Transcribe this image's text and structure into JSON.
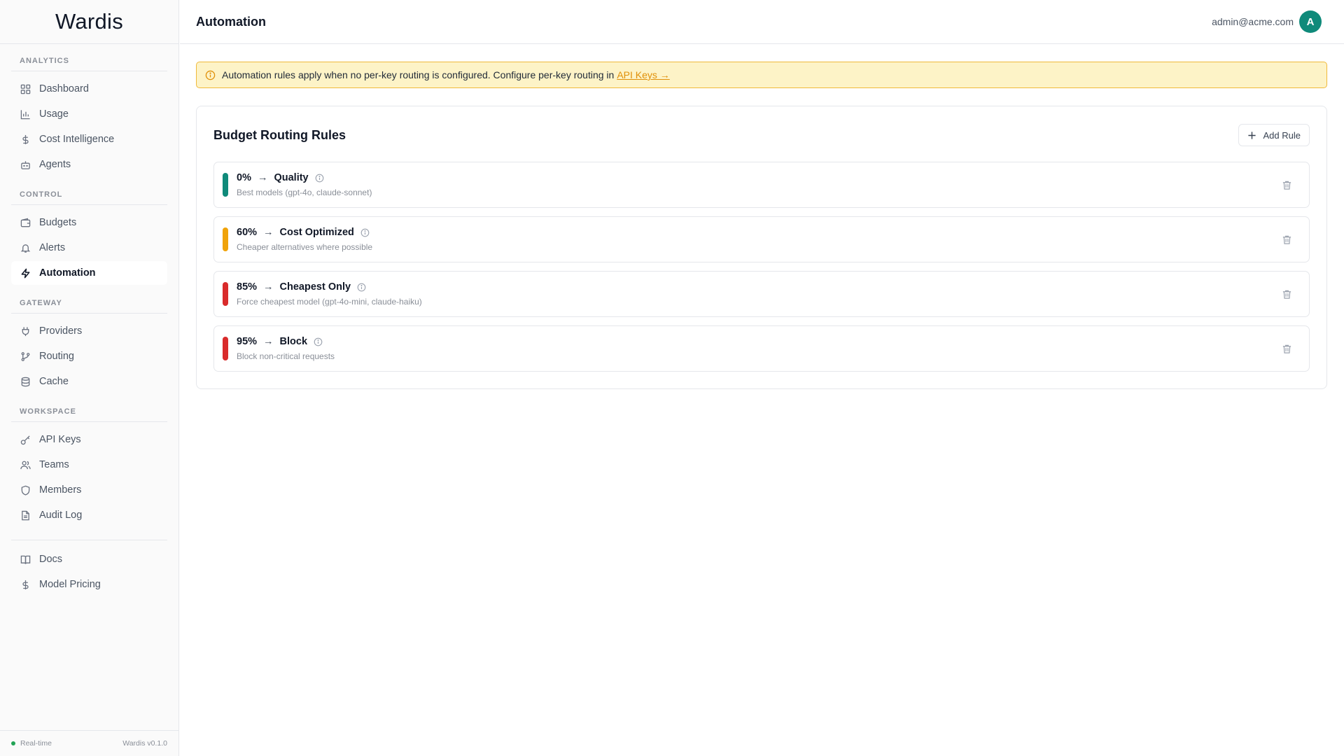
{
  "brand": "Wardis",
  "sidebar": {
    "sections": [
      {
        "label": "ANALYTICS",
        "items": [
          {
            "label": "Dashboard",
            "icon": "grid-icon"
          },
          {
            "label": "Usage",
            "icon": "bar-chart-icon"
          },
          {
            "label": "Cost Intelligence",
            "icon": "dollar-icon"
          },
          {
            "label": "Agents",
            "icon": "bot-icon"
          }
        ]
      },
      {
        "label": "CONTROL",
        "items": [
          {
            "label": "Budgets",
            "icon": "wallet-icon"
          },
          {
            "label": "Alerts",
            "icon": "bell-icon"
          },
          {
            "label": "Automation",
            "icon": "zap-icon",
            "active": true
          }
        ]
      },
      {
        "label": "GATEWAY",
        "items": [
          {
            "label": "Providers",
            "icon": "plug-icon"
          },
          {
            "label": "Routing",
            "icon": "git-branch-icon"
          },
          {
            "label": "Cache",
            "icon": "database-icon"
          }
        ]
      },
      {
        "label": "WORKSPACE",
        "items": [
          {
            "label": "API Keys",
            "icon": "key-icon"
          },
          {
            "label": "Teams",
            "icon": "users-icon"
          },
          {
            "label": "Members",
            "icon": "shield-icon"
          },
          {
            "label": "Audit Log",
            "icon": "file-text-icon"
          }
        ]
      }
    ],
    "bottom_items": [
      {
        "label": "Docs",
        "icon": "book-icon"
      },
      {
        "label": "Model Pricing",
        "icon": "dollar-icon"
      }
    ],
    "footer": {
      "status": "Real-time",
      "version": "Wardis v0.1.0",
      "status_color": "#22a355"
    }
  },
  "header": {
    "title": "Automation",
    "user_email": "admin@acme.com",
    "avatar_initial": "A",
    "avatar_color": "#0f8a7a"
  },
  "alert": {
    "text": "Automation rules apply when no per-key routing is configured. Configure per-key routing in",
    "link": "API Keys →",
    "icon": "info-icon"
  },
  "card": {
    "title": "Budget Routing Rules",
    "add_label": "Add Rule",
    "rules": [
      {
        "threshold": "0%",
        "arrow": "→",
        "name": "Quality",
        "desc": "Best models (gpt-4o, claude-sonnet)",
        "color": "#0f8a7a"
      },
      {
        "threshold": "60%",
        "arrow": "→",
        "name": "Cost Optimized",
        "desc": "Cheaper alternatives where possible",
        "color": "#f0a30a"
      },
      {
        "threshold": "85%",
        "arrow": "→",
        "name": "Cheapest Only",
        "desc": "Force cheapest model (gpt-4o-mini, claude-haiku)",
        "color": "#d92b2b"
      },
      {
        "threshold": "95%",
        "arrow": "→",
        "name": "Block",
        "desc": "Block non-critical requests",
        "color": "#d92b2b"
      }
    ]
  }
}
